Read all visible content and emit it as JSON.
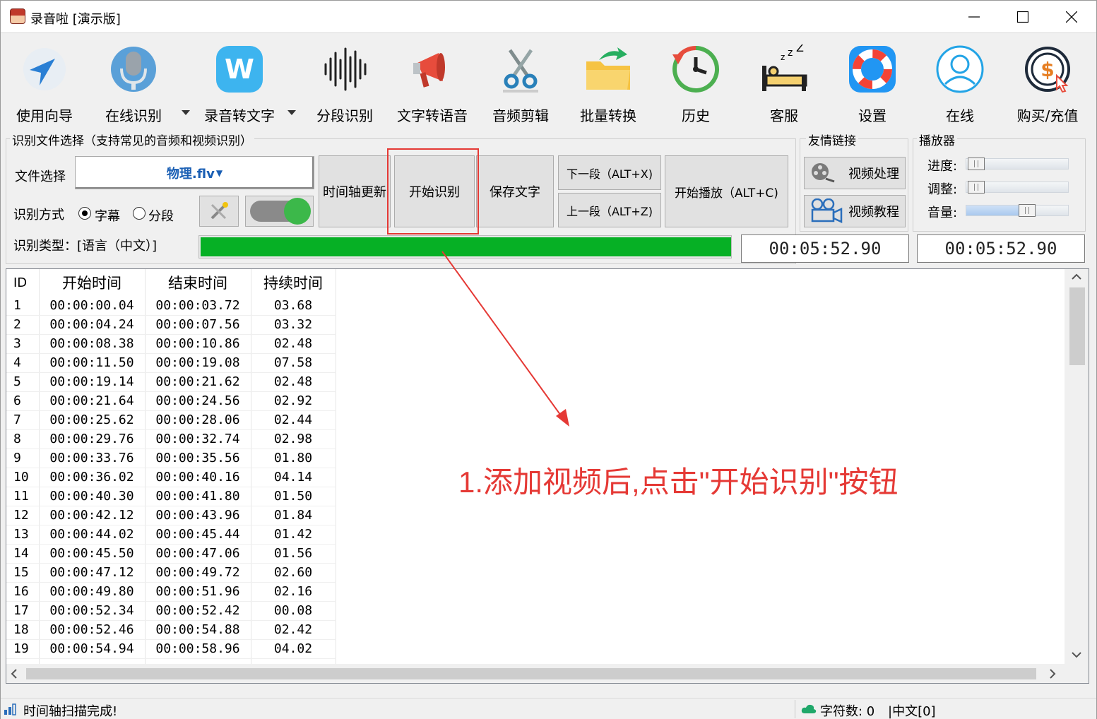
{
  "window": {
    "title": "录音啦 [演示版]",
    "controls": [
      "minimize",
      "maximize",
      "close"
    ]
  },
  "toolbar": [
    {
      "label": "使用向导",
      "icon": "navigation-arrow-icon"
    },
    {
      "label": "在线识别",
      "icon": "microphone-icon",
      "dropdown": true
    },
    {
      "label": "录音转文字",
      "icon": "w-logo-icon",
      "dropdown": true
    },
    {
      "label": "分段识别",
      "icon": "waveform-icon"
    },
    {
      "label": "文字转语音",
      "icon": "megaphone-icon"
    },
    {
      "label": "音频剪辑",
      "icon": "scissors-icon"
    },
    {
      "label": "批量转换",
      "icon": "folder-convert-icon"
    },
    {
      "label": "历史",
      "icon": "history-clock-icon"
    },
    {
      "label": "客服",
      "icon": "sleeping-bed-icon"
    },
    {
      "label": "设置",
      "icon": "lifebuoy-icon"
    },
    {
      "label": "在线",
      "icon": "user-online-icon"
    },
    {
      "label": "购买/充值",
      "icon": "dollar-coin-icon"
    }
  ],
  "recognition": {
    "group_title": "识别文件选择（支持常见的音频和视频识别）",
    "file_label": "文件选择",
    "file_value": "物理.flv",
    "mode_label": "识别方式",
    "mode_options": [
      "字幕",
      "分段"
    ],
    "mode_selected": "字幕",
    "type_text": "识别类型：[语言（中文）]",
    "buttons": {
      "timeline_update": "时间轴更新",
      "start_recognition": "开始识别",
      "save_text": "保存文字",
      "next_segment": "下一段（ALT+X)",
      "prev_segment": "上一段（ALT+Z)",
      "start_play": "开始播放（ALT+C)"
    },
    "progress": 1.0,
    "progress_color": "#06b025"
  },
  "links": {
    "group_title": "友情链接",
    "video_process": "视频处理",
    "video_tutorial": "视频教程"
  },
  "player": {
    "group_title": "播放器",
    "progress_label": "进度:",
    "adjust_label": "调整:",
    "volume_label": "音量:",
    "progress_level": 0.0,
    "adjust_level": 0.0,
    "volume_level": 0.6
  },
  "time_display": {
    "left": "00:05:52.90",
    "right": "00:05:52.90"
  },
  "table": {
    "columns": [
      "ID",
      "开始时间",
      "结束时间",
      "持续时间"
    ],
    "rows": [
      [
        "1",
        "00:00:00.04",
        "00:00:03.72",
        "03.68"
      ],
      [
        "2",
        "00:00:04.24",
        "00:00:07.56",
        "03.32"
      ],
      [
        "3",
        "00:00:08.38",
        "00:00:10.86",
        "02.48"
      ],
      [
        "4",
        "00:00:11.50",
        "00:00:19.08",
        "07.58"
      ],
      [
        "5",
        "00:00:19.14",
        "00:00:21.62",
        "02.48"
      ],
      [
        "6",
        "00:00:21.64",
        "00:00:24.56",
        "02.92"
      ],
      [
        "7",
        "00:00:25.62",
        "00:00:28.06",
        "02.44"
      ],
      [
        "8",
        "00:00:29.76",
        "00:00:32.74",
        "02.98"
      ],
      [
        "9",
        "00:00:33.76",
        "00:00:35.56",
        "01.80"
      ],
      [
        "10",
        "00:00:36.02",
        "00:00:40.16",
        "04.14"
      ],
      [
        "11",
        "00:00:40.30",
        "00:00:41.80",
        "01.50"
      ],
      [
        "12",
        "00:00:42.12",
        "00:00:43.96",
        "01.84"
      ],
      [
        "13",
        "00:00:44.02",
        "00:00:45.44",
        "01.42"
      ],
      [
        "14",
        "00:00:45.50",
        "00:00:47.06",
        "01.56"
      ],
      [
        "15",
        "00:00:47.12",
        "00:00:49.72",
        "02.60"
      ],
      [
        "16",
        "00:00:49.80",
        "00:00:51.96",
        "02.16"
      ],
      [
        "17",
        "00:00:52.34",
        "00:00:52.42",
        "00.08"
      ],
      [
        "18",
        "00:00:52.46",
        "00:00:54.88",
        "02.42"
      ],
      [
        "19",
        "00:00:54.94",
        "00:00:58.96",
        "04.02"
      ]
    ]
  },
  "annotation": {
    "text": "1.添加视频后,点击\"开始识别\"按钮",
    "color": "#e53935"
  },
  "status": {
    "left_text": "时间轴扫描完成!",
    "char_count": "字符数: 0",
    "lang": "|中文[0]"
  }
}
